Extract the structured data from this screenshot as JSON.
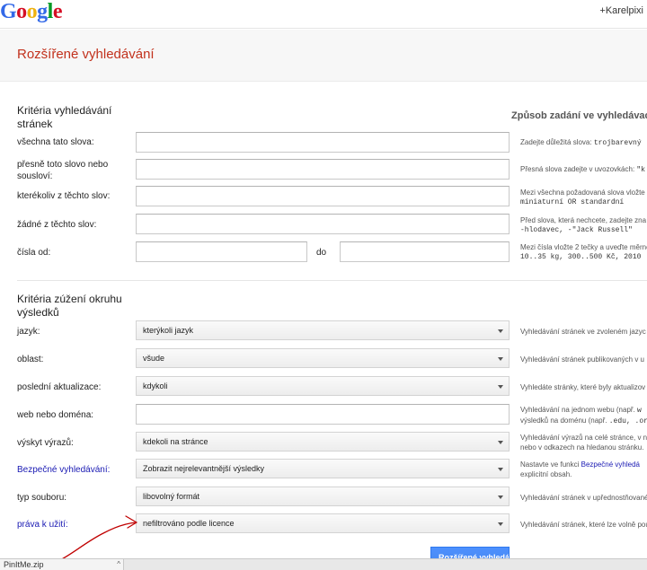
{
  "header": {
    "logo_letters": [
      {
        "ch": "G",
        "color": "#3369e8"
      },
      {
        "ch": "o",
        "color": "#d50f25"
      },
      {
        "ch": "o",
        "color": "#eeb211"
      },
      {
        "ch": "g",
        "color": "#3369e8"
      },
      {
        "ch": "l",
        "color": "#009925"
      },
      {
        "ch": "e",
        "color": "#d50f25"
      }
    ],
    "user": "+Karelpixi"
  },
  "page": {
    "title": "Rozšířené vyhledávání"
  },
  "section1": {
    "heading": "Kritéria vyhledávání stránek",
    "right_heading": "Způsob zadání ve vyhledávacím",
    "rows": [
      {
        "label": "všechna tato slova:",
        "hint": "Zadejte důležitá slova: ",
        "hint_mono": "trojbarevný"
      },
      {
        "label": "přesně toto slovo nebo sousloví:",
        "hint": "Přesná slova zadejte v uvozovkách: ",
        "hint_mono": "\"k"
      },
      {
        "label": "kterékoliv z těchto slov:",
        "hint": "Mezi všechna požadovaná slova vložte",
        "hint_mono": "miniaturní OR standardní"
      },
      {
        "label": "žádné z těchto slov:",
        "hint": "Před slova, která nechcete, zadejte zna",
        "hint_mono": "-hlodavec, -\"Jack Russell\""
      },
      {
        "label": "čísla od:",
        "hint": "Mezi čísla vložte 2 tečky a uveďte měrno",
        "hint_mono": "10..35 kg, 300..500 Kč, 2010"
      }
    ],
    "range_to": "do"
  },
  "section2": {
    "heading": "Kritéria zúžení okruhu výsledků",
    "rows": [
      {
        "label": "jazyk:",
        "value": "kterýkoli jazyk",
        "hint": "Vyhledávání stránek ve zvoleném jazyc"
      },
      {
        "label": "oblast:",
        "value": "všude",
        "hint": "Vyhledávání stránek publikovaných v u"
      },
      {
        "label": "poslední aktualizace:",
        "value": "kdykoli",
        "hint": "Vyhledáte stránky, které byly aktualizov"
      },
      {
        "label": "web nebo doména:",
        "hint1": "Vyhledávání na jednom webu (např.",
        "hint1_mono": "w",
        "hint2": "výsledků na doménu (např.",
        "hint2_mono": ".edu, .org"
      },
      {
        "label": "výskyt výrazů:",
        "value": "kdekoli na stránce",
        "hint1": "Vyhledávání výrazů na celé stránce, v n",
        "hint2": "nebo v odkazech na hledanou stránku."
      },
      {
        "label": "Bezpečné vyhledávání:",
        "value": "Zobrazit nejrelevantnější výsledky",
        "hint1": "Nastavte ve funkci",
        "hint1_link": "Bezpečné vyhledá",
        "hint2": "explicitní obsah."
      },
      {
        "label": "typ souboru:",
        "value": "libovolný formát",
        "hint": "Vyhledávání stránek v upřednostňované"
      },
      {
        "label": "práva k užití:",
        "value": "nefiltrováno podle licence",
        "hint": "Vyhledávání stránek, které lze volně pou"
      }
    ],
    "submit": "Rozšířené vyhledávání"
  },
  "taskbar": {
    "item": "PinItMe.zip",
    "caret": "^"
  },
  "colors": {
    "title": "#c2321d",
    "link": "#1a1ab3",
    "button": "#4d90fe",
    "annotation": "#c00000"
  }
}
